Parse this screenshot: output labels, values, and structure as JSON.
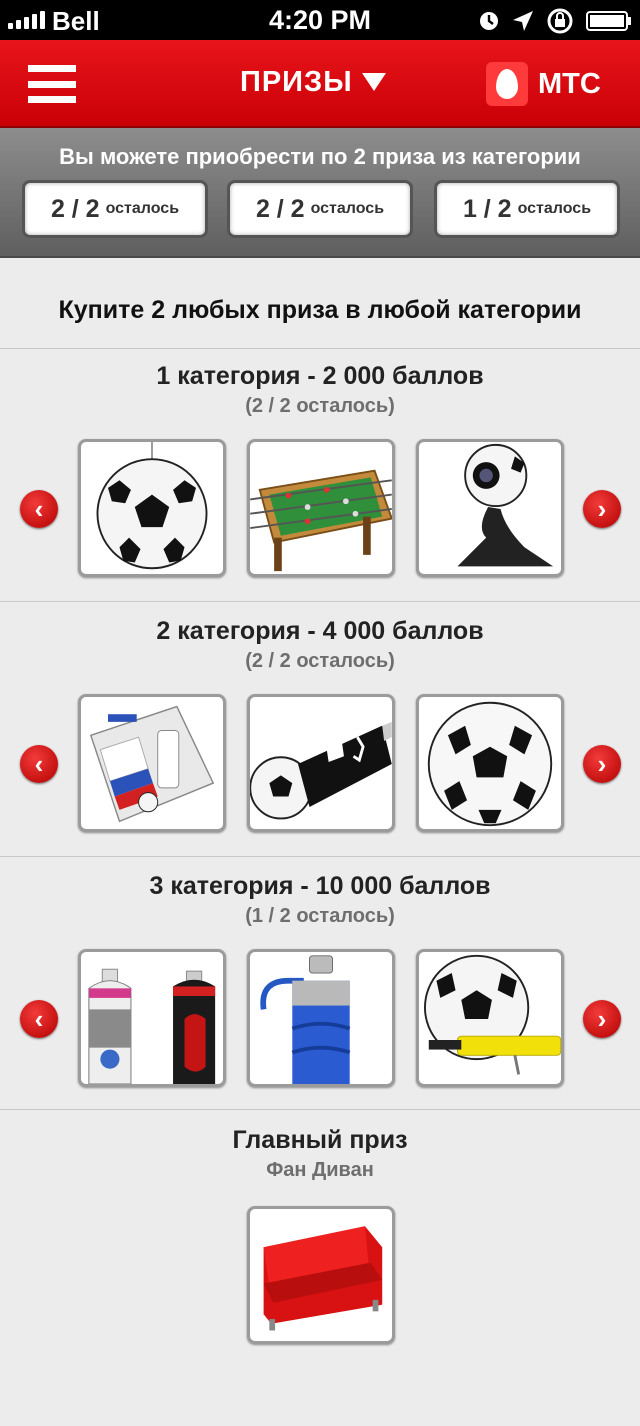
{
  "status_bar": {
    "carrier": "Bell",
    "time": "4:20 PM"
  },
  "header": {
    "title": "ПРИЗЫ",
    "logo_text": "МТС"
  },
  "quota": {
    "title": "Вы можете приобрести по 2 приза из категории",
    "boxes": [
      {
        "value": "2 / 2",
        "label": "осталось"
      },
      {
        "value": "2 / 2",
        "label": "осталось"
      },
      {
        "value": "1 / 2",
        "label": "осталось"
      }
    ]
  },
  "intro": "Купите 2 любых приза в любой категории",
  "categories": [
    {
      "title": "1 категория - 2 000 баллов",
      "remaining": "(2 / 2 осталось)",
      "items": [
        "soccer-lamp",
        "foosball-table",
        "soccer-webcam"
      ]
    },
    {
      "title": "2 категория - 4 000 баллов",
      "remaining": "(2 / 2 осталось)",
      "items": [
        "usb-flash-box",
        "usb-flash-soccer",
        "adidas-ball"
      ]
    },
    {
      "title": "3 категория - 10 000 баллов",
      "remaining": "(1 / 2 осталось)",
      "items": [
        "spray-cans",
        "water-bottle",
        "ball-with-pump"
      ]
    }
  ],
  "main_prize": {
    "title": "Главный приз",
    "name": "Фан Диван",
    "item": "red-sofa"
  },
  "icons": {
    "prev": "chevron-left",
    "next": "chevron-right",
    "menu": "hamburger"
  },
  "colors": {
    "brand_red": "#e30613",
    "quota_bg": "#7a7a7a",
    "page_bg": "#ececec"
  }
}
